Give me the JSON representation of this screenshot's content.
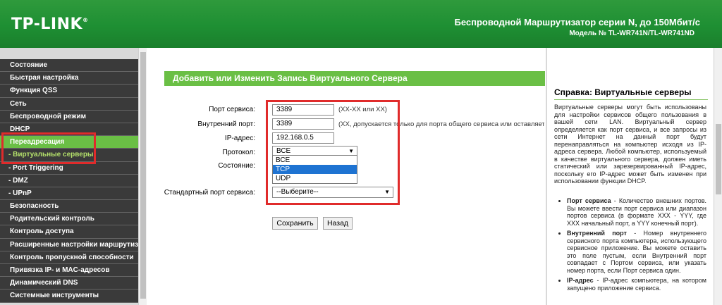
{
  "header": {
    "logo": "TP-LINK",
    "logo_mark": "®",
    "title": "Беспроводной Маршрутизатор серии N, до 150Мбит/с",
    "model": "Модель № TL-WR741N/TL-WR741ND"
  },
  "menu": {
    "items": [
      "Состояние",
      "Быстрая настройка",
      "Функция QSS",
      "Сеть",
      "Беспроводной режим",
      "DHCP",
      "Переадресация",
      "- Виртуальные серверы",
      "- Port Triggering",
      "- DMZ",
      "- UPnP",
      "Безопасность",
      "Родительский контроль",
      "Контроль доступа",
      "Расширенные настройки маршрутизации",
      "Контроль пропускной способности",
      "Привязка IP- и MAC-адресов",
      "Динамический DNS",
      "Системные инструменты"
    ]
  },
  "form": {
    "title": "Добавить или Изменить Запись Виртуального Сервера",
    "service_port_label": "Порт сервиса:",
    "service_port_value": "3389",
    "service_port_hint": "(XX-XX или XX)",
    "internal_port_label": "Внутренний порт:",
    "internal_port_value": "3389",
    "internal_port_hint": "(XX, допускается только для порта общего сервиса или оставляется пустым)",
    "ip_label": "IP-адрес:",
    "ip_value": "192.168.0.5",
    "protocol_label": "Протокол:",
    "protocol_value": "ВСЕ",
    "protocol_options": [
      "ВСЕ",
      "TCP",
      "UDP"
    ],
    "state_label": "Состояние:",
    "std_port_label": "Стандартный порт сервиса:",
    "std_port_value": "--Выберите--",
    "save_label": "Сохранить",
    "back_label": "Назад"
  },
  "help": {
    "title": "Справка: Виртуальные серверы",
    "intro": "Виртуальные серверы могут быть использованы для настройки сервисов общего пользования в вашей сети LAN. Виртуальный сервер определяется как порт сервиса, и все запросы из сети Интернет на данный порт будут перенаправляться на компьютер исходя из IP-адреса сервера. Любой компьютер, используемый в качестве виртуального сервера, должен иметь статический или зарезервированный IP-адрес, поскольку его IP-адрес может быть изменен при использовании функции DHCP.",
    "items": [
      {
        "term": "Порт сервиса",
        "text": " - Количество внешних портов. Вы можете ввести порт сервиса или диапазон портов сервиса (в формате XXX - YYY, где XXX начальный порт, а YYY конечный порт)."
      },
      {
        "term": "Внутренний порт",
        "text": " - Номер внутреннего сервисного порта компьютера, использующего сервисное приложение. Вы можете оставить это поле пустым, если Внутренний порт совпадает с Портом сервиса, или указать номер порта, если Порт сервиса один."
      },
      {
        "term": "IP-адрес",
        "text": " - IP-адрес компьютера, на котором запущено приложение сервиса."
      }
    ]
  }
}
